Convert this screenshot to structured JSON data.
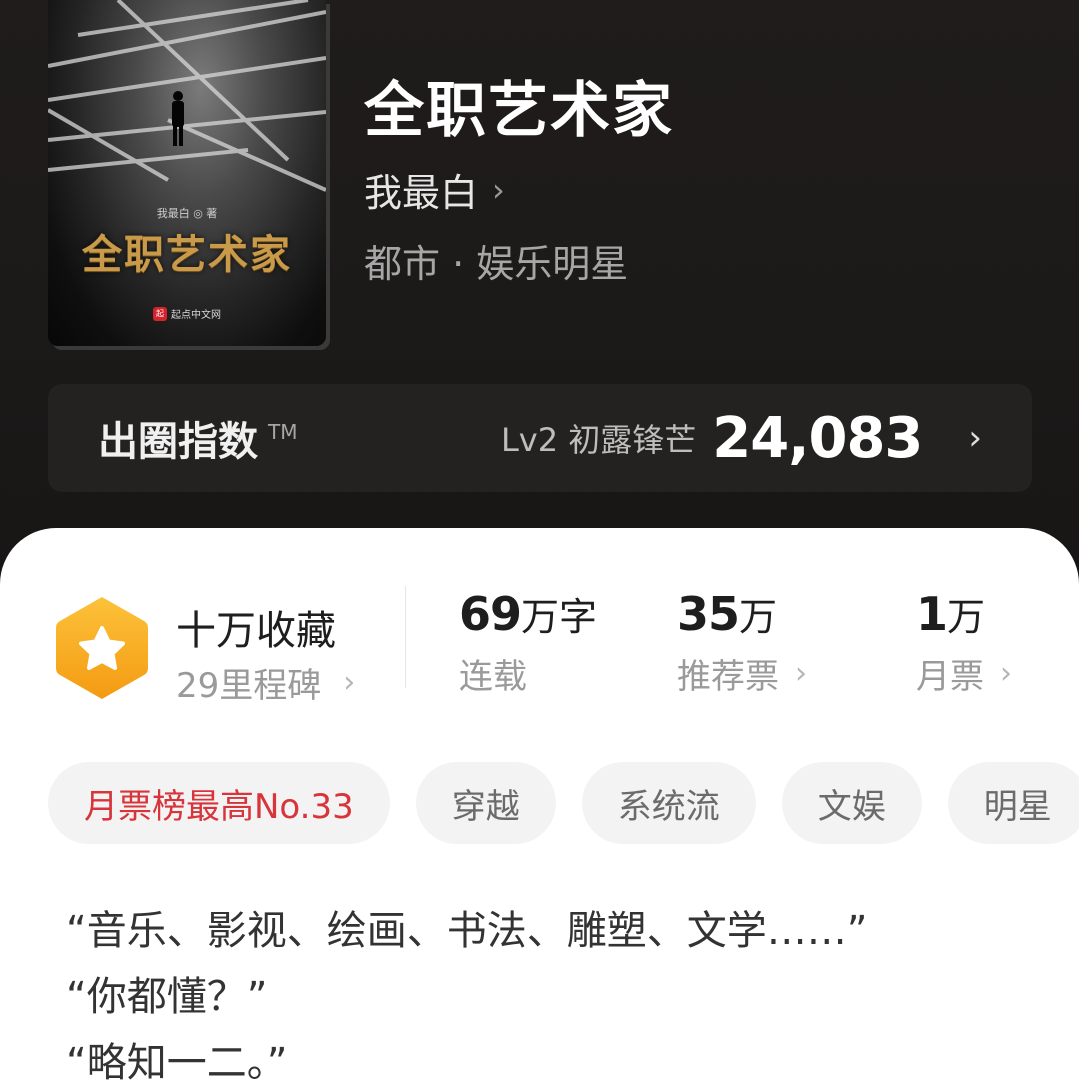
{
  "cover": {
    "author_line": "我最白 ◎ 著",
    "title": "全职艺术家",
    "publisher": "起点中文网",
    "publisher_logo": "起"
  },
  "book": {
    "title": "全职艺术家",
    "author": "我最白",
    "genre": "都市 · 娱乐明星"
  },
  "index": {
    "label": "出圈指数",
    "tm": "TM",
    "level": "Lv2 初露锋芒",
    "value": "24,083"
  },
  "stats": {
    "collect": {
      "title": "十万收藏",
      "subtitle": "29里程碑"
    },
    "words": {
      "value": "69",
      "unit": "万字",
      "label": "连载"
    },
    "recommend": {
      "value": "35",
      "unit": "万",
      "label": "推荐票"
    },
    "monthly": {
      "value": "1",
      "unit": "万",
      "label": "月票"
    }
  },
  "tags": [
    "月票榜最高No.33",
    "穿越",
    "系统流",
    "文娱",
    "明星"
  ],
  "intro": [
    "“音乐、影视、绘画、书法、雕塑、文学……”",
    "“你都懂？”",
    "“略知一二。”"
  ],
  "colors": {
    "accent_red": "#d8343b",
    "badge_orange": "#f8a21a",
    "cover_gold": "#c89a49"
  }
}
